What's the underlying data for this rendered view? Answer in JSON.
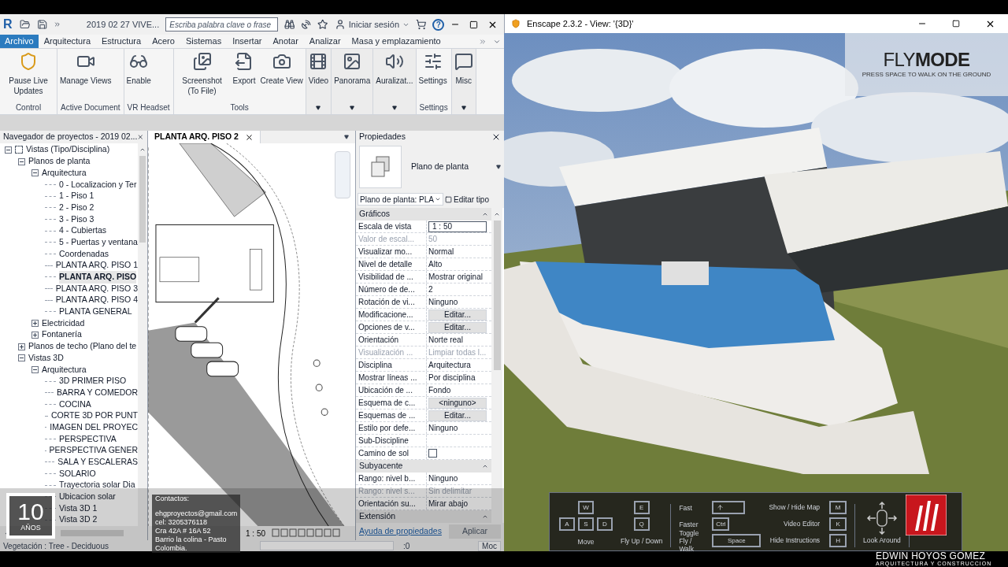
{
  "revit": {
    "logo": "R",
    "title": "2019 02 27 VIVE...",
    "search": {
      "placeholder": "Escriba palabra clave o frase"
    },
    "sign_in": "Iniciar sesión",
    "help": "?",
    "tabs": [
      {
        "label": "Archivo",
        "selected": true
      },
      {
        "label": "Arquitectura",
        "selected": false
      },
      {
        "label": "Estructura",
        "selected": false
      },
      {
        "label": "Acero",
        "selected": false
      },
      {
        "label": "Sistemas",
        "selected": false
      },
      {
        "label": "Insertar",
        "selected": false
      },
      {
        "label": "Anotar",
        "selected": false
      },
      {
        "label": "Analizar",
        "selected": false
      },
      {
        "label": "Masa y emplazamiento",
        "selected": false
      }
    ],
    "ribbon": [
      {
        "kind": "labeled",
        "label": "Control",
        "buttons": [
          "Pause Live Updates"
        ]
      },
      {
        "kind": "labeled",
        "label": "Active Document",
        "buttons": [
          "Manage Views"
        ]
      },
      {
        "kind": "labeled",
        "label": "VR Headset",
        "buttons": [
          "Enable"
        ]
      },
      {
        "kind": "labeled",
        "label": "Tools",
        "buttons": [
          "Screenshot (To File)",
          "Export",
          "Create View"
        ]
      },
      {
        "kind": "dropdown",
        "buttons": [
          "Video"
        ]
      },
      {
        "kind": "dropdown",
        "buttons": [
          "Panorama"
        ]
      },
      {
        "kind": "dropdown",
        "buttons": [
          "Auralizat..."
        ]
      },
      {
        "kind": "labeled",
        "label": "Settings",
        "buttons": [
          "Settings"
        ]
      },
      {
        "kind": "dropdown",
        "buttons": [
          "Misc"
        ]
      }
    ],
    "browser": {
      "title": "Navegador de proyectos - 2019 02...",
      "tree": [
        {
          "label": "Vistas (Tipo/Disciplina)",
          "selected": false,
          "expanded": true,
          "children": [
            {
              "label": "Planos de planta",
              "selected": false,
              "expanded": true,
              "children": [
                {
                  "label": "Arquitectura",
                  "selected": false,
                  "expanded": true,
                  "children": [
                    {
                      "label": "0 - Localizacion y Ter",
                      "selected": false
                    },
                    {
                      "label": "1 - Piso 1",
                      "selected": false
                    },
                    {
                      "label": "2 - Piso 2",
                      "selected": false
                    },
                    {
                      "label": "3 - Piso 3",
                      "selected": false
                    },
                    {
                      "label": "4 - Cubiertas",
                      "selected": false
                    },
                    {
                      "label": "5 - Puertas y ventana",
                      "selected": false
                    },
                    {
                      "label": "Coordenadas",
                      "selected": false
                    },
                    {
                      "label": "PLANTA ARQ. PISO 1",
                      "selected": false
                    },
                    {
                      "label": "PLANTA ARQ. PISO",
                      "selected": true
                    },
                    {
                      "label": "PLANTA ARQ. PISO 3",
                      "selected": false
                    },
                    {
                      "label": "PLANTA ARQ. PISO 4",
                      "selected": false
                    },
                    {
                      "label": "PLANTA GENERAL",
                      "selected": false
                    }
                  ]
                },
                {
                  "label": "Electricidad",
                  "selected": false,
                  "expanded": false
                },
                {
                  "label": "Fontanería",
                  "selected": false,
                  "expanded": false
                }
              ]
            },
            {
              "label": "Planos de techo (Plano del te",
              "selected": false,
              "expanded": false
            },
            {
              "label": "Vistas 3D",
              "selected": false,
              "expanded": true,
              "children": [
                {
                  "label": "Arquitectura",
                  "selected": false,
                  "expanded": true,
                  "children": [
                    {
                      "label": "3D PRIMER PISO",
                      "selected": false
                    },
                    {
                      "label": "BARRA Y COMEDOR",
                      "selected": false
                    },
                    {
                      "label": "COCINA",
                      "selected": false
                    },
                    {
                      "label": "CORTE 3D POR PUNT",
                      "selected": false
                    },
                    {
                      "label": "IMAGEN DEL PROYEC",
                      "selected": false
                    },
                    {
                      "label": "PERSPECTIVA",
                      "selected": false
                    },
                    {
                      "label": "PERSPECTIVA GENER",
                      "selected": false
                    },
                    {
                      "label": "SALA Y ESCALERAS",
                      "selected": false
                    },
                    {
                      "label": "SOLARIO",
                      "selected": false
                    },
                    {
                      "label": "Trayectoria solar Dia",
                      "selected": false
                    },
                    {
                      "label": "Ubicacion solar",
                      "selected": false
                    },
                    {
                      "label": "Vista 3D 1",
                      "selected": false
                    },
                    {
                      "label": "Vista 3D 2",
                      "selected": false
                    }
                  ]
                }
              ]
            }
          ]
        }
      ]
    },
    "view": {
      "tab": "PLANTA ARQ. PISO 2",
      "scale": "1 : 50"
    },
    "properties": {
      "title": "Propiedades",
      "type": "Plano de planta",
      "selector": "Plano de planta: PLA",
      "edit_type": "Editar tipo",
      "sections": [
        {
          "title": "Gráficos",
          "rows": [
            {
              "name": "Escala de vista",
              "value": "1 : 50",
              "kind": "input"
            },
            {
              "name": "Valor de escal...",
              "value": "50",
              "kind": "disabled"
            },
            {
              "name": "Visualizar mo...",
              "value": "Normal",
              "kind": "text"
            },
            {
              "name": "Nivel de detalle",
              "value": "Alto",
              "kind": "text"
            },
            {
              "name": "Visibilidad de ...",
              "value": "Mostrar original",
              "kind": "text"
            },
            {
              "name": "Número de de...",
              "value": "2",
              "kind": "text"
            },
            {
              "name": "Rotación de vi...",
              "value": "Ninguno",
              "kind": "text"
            },
            {
              "name": "Modificacione...",
              "value": "Editar...",
              "kind": "button"
            },
            {
              "name": "Opciones de v...",
              "value": "Editar...",
              "kind": "button"
            },
            {
              "name": "Orientación",
              "value": "Norte real",
              "kind": "text"
            },
            {
              "name": "Visualización ...",
              "value": "Limpiar todas l...",
              "kind": "disabled"
            },
            {
              "name": "Disciplina",
              "value": "Arquitectura",
              "kind": "text"
            },
            {
              "name": "Mostrar líneas ...",
              "value": "Por disciplina",
              "kind": "text"
            },
            {
              "name": "Ubicación de ...",
              "value": "Fondo",
              "kind": "text"
            },
            {
              "name": "Esquema de c...",
              "value": "<ninguno>",
              "kind": "button"
            },
            {
              "name": "Esquemas de ...",
              "value": "Editar...",
              "kind": "button"
            },
            {
              "name": "Estilo por defe...",
              "value": "Ninguno",
              "kind": "text"
            },
            {
              "name": "Sub-Discipline",
              "kind": "text"
            },
            {
              "name": "Camino de sol",
              "kind": "checkbox",
              "checked": false
            }
          ]
        },
        {
          "title": "Subyacente",
          "rows": [
            {
              "name": "Rango: nivel b...",
              "value": "Ninguno",
              "kind": "text"
            },
            {
              "name": "Rango: nivel s...",
              "value": "Sin delimitar",
              "kind": "disabled"
            },
            {
              "name": "Orientación su...",
              "value": "Mirar abajo",
              "kind": "text"
            }
          ]
        },
        {
          "title": "Extensión"
        }
      ],
      "help_link": "Ayuda de propiedades",
      "apply": {
        "label": "Aplicar",
        "disabled": true
      }
    },
    "status": {
      "text": "Vegetación : Tree - Deciduous",
      "count": ":0",
      "mode": "Moc"
    }
  },
  "enscape": {
    "title": "Enscape 2.3.2 - View: '{3D}'",
    "mode_title": "FLY**MODE**",
    "mode_hint": "PRESS SPACE TO WALK ON THE GROUND",
    "move": {
      "label": "Move",
      "keys": [
        "W",
        "A",
        "S",
        "D"
      ]
    },
    "fly": {
      "label": "Fly Up / Down",
      "keys": [
        "E",
        "Q"
      ]
    },
    "speed": [
      {
        "label": "Fast",
        "kind": "shift"
      },
      {
        "label": "Faster",
        "kind": "key",
        "key": "Ctrl"
      },
      {
        "label": "Toggle Fly / Walk",
        "kind": "wide",
        "key": "Space"
      }
    ],
    "toggles": [
      {
        "label": "Show / Hide Map",
        "key": "M"
      },
      {
        "label": "Video Editor",
        "key": "K"
      },
      {
        "label": "Hide Instructions",
        "key": "H"
      }
    ],
    "look": {
      "label": "Look Around"
    }
  },
  "overlay": {
    "badge_number": "10",
    "badge_text": "AÑOS",
    "contacts": [
      "Contactos:",
      "ehgproyectos@gmail.com",
      "cel: 3205376118",
      "Cra 42A # 16A 52",
      "Barrio la colina - Pasto",
      "Colombia."
    ],
    "brand": "EDWIN HOYOS GOMEZ",
    "brand_sub": "ARQUITECTURA Y CONSTRUCCION"
  }
}
